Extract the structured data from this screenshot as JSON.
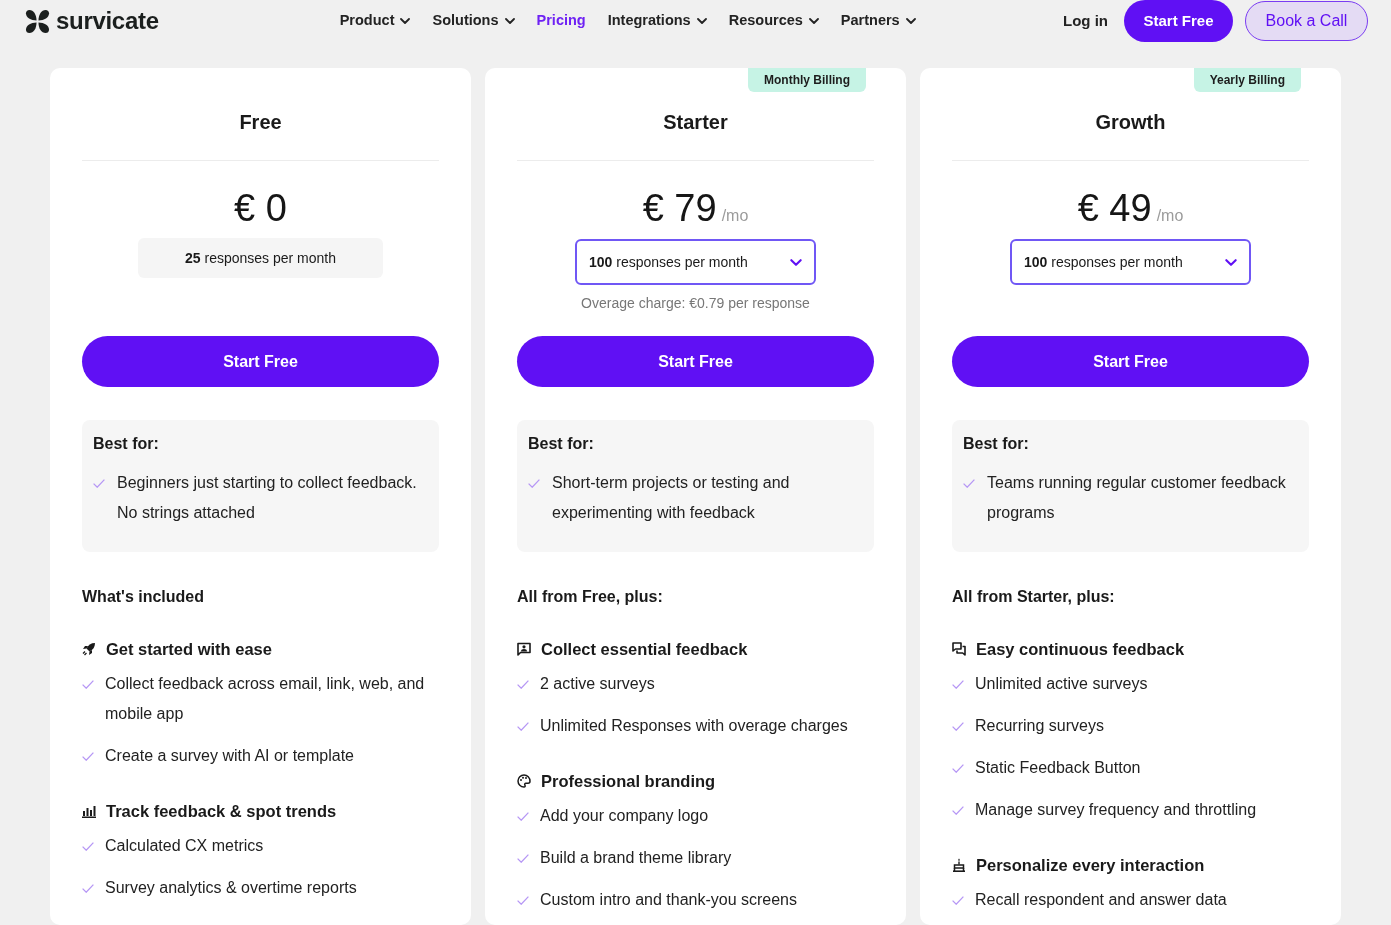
{
  "header": {
    "logo": "survicate",
    "nav": [
      {
        "label": "Product",
        "dropdown": true,
        "selected": false
      },
      {
        "label": "Solutions",
        "dropdown": true,
        "selected": false
      },
      {
        "label": "Pricing",
        "dropdown": false,
        "selected": true
      },
      {
        "label": "Integrations",
        "dropdown": true,
        "selected": false
      },
      {
        "label": "Resources",
        "dropdown": true,
        "selected": false
      },
      {
        "label": "Partners",
        "dropdown": true,
        "selected": false
      }
    ],
    "actions": [
      {
        "kind": "link",
        "label": "Log in"
      },
      {
        "kind": "primary",
        "label": "Start Free"
      },
      {
        "kind": "outline",
        "label": "Book a Call"
      }
    ]
  },
  "plans": [
    {
      "name": "Free",
      "price": "€ 0",
      "responses": {
        "kind": "static",
        "text": "**25** responses per month"
      },
      "button": "Start Free",
      "best_for": {
        "title": "Best for:",
        "items": [
          "Beginners just starting to collect feedback. No strings attached"
        ]
      },
      "features_title": "What's included",
      "groups": [
        {
          "title": "Get started with ease",
          "items": [
            "Collect feedback across email, link, web, and mobile app",
            "Create a survey with AI or template"
          ]
        },
        {
          "title": "Track feedback & spot trends",
          "items": [
            "Calculated CX metrics",
            "Survey analytics & overtime reports"
          ]
        }
      ]
    },
    {
      "name": "Starter",
      "badge": "Monthly Billing",
      "price": "€ 79",
      "period": "/mo",
      "responses": {
        "kind": "dropdown",
        "text": "**100** responses per month"
      },
      "overage": "Overage charge: €0.79 per response",
      "button": "Start Free",
      "best_for": {
        "title": "Best for:",
        "items": [
          "Short-term projects or testing and experimenting with feedback"
        ]
      },
      "features_title": "All from Free, plus:",
      "groups": [
        {
          "title": "Collect essential feedback",
          "items": [
            "2 active surveys",
            "Unlimited Responses with overage charges"
          ]
        },
        {
          "title": "Professional branding",
          "items": [
            "Add your company logo",
            "Build a brand theme library",
            "Custom intro and thank-you screens"
          ]
        }
      ]
    },
    {
      "name": "Growth",
      "badge": "Yearly Billing",
      "price": "€ 49",
      "period": "/mo",
      "responses": {
        "kind": "dropdown",
        "text": "**100** responses per month"
      },
      "button": "Start Free",
      "best_for": {
        "title": "Best for:",
        "items": [
          "Teams running regular customer feedback programs"
        ]
      },
      "features_title": "All from Starter, plus:",
      "groups": [
        {
          "title": "Easy continuous feedback",
          "items": [
            "Unlimited active surveys",
            "Recurring surveys",
            "Static Feedback Button",
            "Manage survey frequency and throttling"
          ]
        },
        {
          "title": "Personalize every interaction",
          "items": [
            "Recall respondent and answer data"
          ]
        }
      ]
    }
  ]
}
